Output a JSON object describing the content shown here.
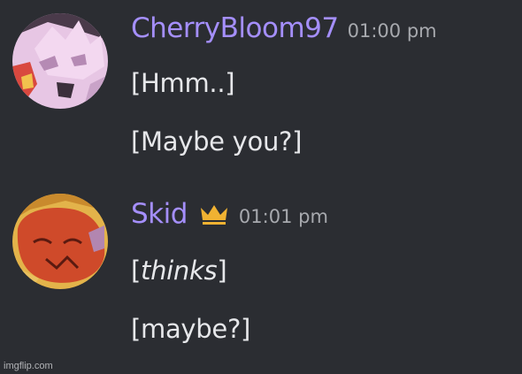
{
  "messages": [
    {
      "username": "CherryBloom97",
      "timestamp": "01:00 pm",
      "avatar": "pink-character-avatar",
      "lines": [
        "[Hmm..]",
        "[Maybe you?]"
      ]
    },
    {
      "username": "Skid",
      "timestamp": "01:01 pm",
      "avatar": "red-character-avatar",
      "badge": "crown-icon",
      "lines": [
        {
          "pre": "[",
          "italic": "thinks",
          "post": "]"
        },
        "[maybe?]"
      ]
    }
  ],
  "watermark": "imgflip.com",
  "colors": {
    "background": "#2b2d32",
    "username": "#a58ffd",
    "message_text": "#e6e7ea",
    "timestamp": "#a7a9ae",
    "crown": "#f0b232"
  }
}
